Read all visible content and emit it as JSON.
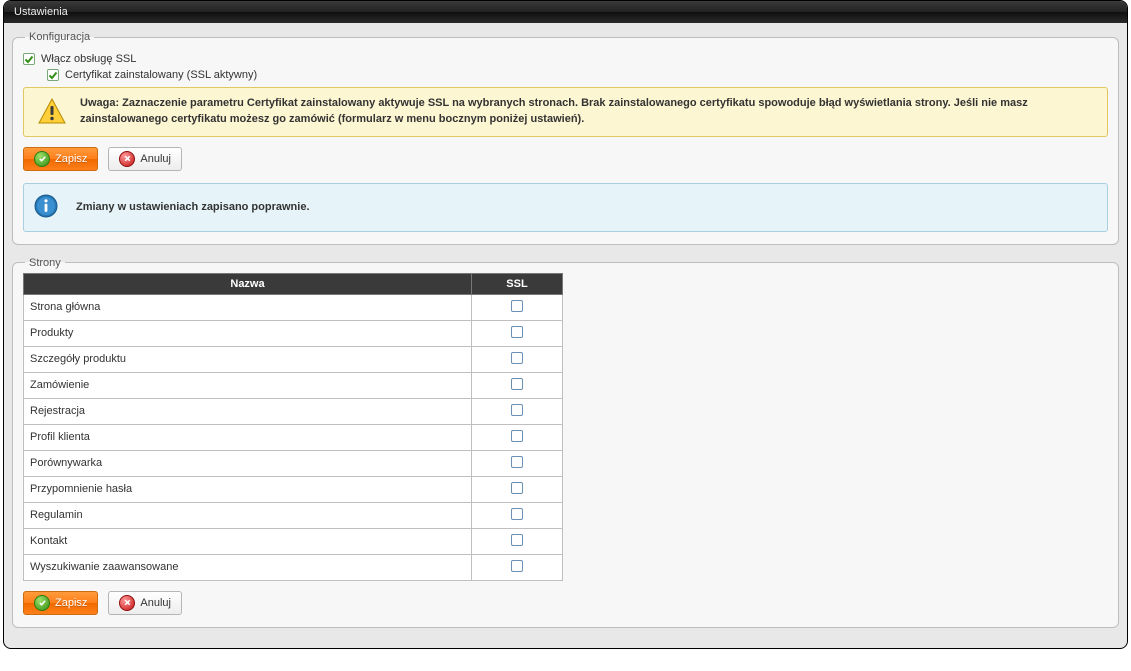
{
  "window": {
    "title": "Ustawienia"
  },
  "config": {
    "legend": "Konfiguracja",
    "enable_ssl_label": "Włącz obsługę SSL",
    "enable_ssl_checked": true,
    "cert_installed_label": "Certyfikat zainstalowany (SSL aktywny)",
    "cert_installed_checked": true,
    "warning": "Uwaga: Zaznaczenie parametru Certyfikat zainstalowany aktywuje SSL na wybranych stronach. Brak zainstalowanego certyfikatu spowoduje błąd wyświetlania strony. Jeśli nie masz zainstalowanego certyfikatu możesz go zamówić (formularz w menu bocznym poniżej ustawień).",
    "save_label": "Zapisz",
    "cancel_label": "Anuluj",
    "info_message": "Zmiany w ustawieniach zapisano poprawnie."
  },
  "pages": {
    "legend": "Strony",
    "col_name": "Nazwa",
    "col_ssl": "SSL",
    "rows": [
      {
        "name": "Strona główna",
        "ssl": false
      },
      {
        "name": "Produkty",
        "ssl": false
      },
      {
        "name": "Szczegóły produktu",
        "ssl": false
      },
      {
        "name": "Zamówienie",
        "ssl": false
      },
      {
        "name": "Rejestracja",
        "ssl": false
      },
      {
        "name": "Profil klienta",
        "ssl": false
      },
      {
        "name": "Porównywarka",
        "ssl": false
      },
      {
        "name": "Przypomnienie hasła",
        "ssl": false
      },
      {
        "name": "Regulamin",
        "ssl": false
      },
      {
        "name": "Kontakt",
        "ssl": false
      },
      {
        "name": "Wyszukiwanie zaawansowane",
        "ssl": false
      }
    ],
    "save_label": "Zapisz",
    "cancel_label": "Anuluj"
  }
}
